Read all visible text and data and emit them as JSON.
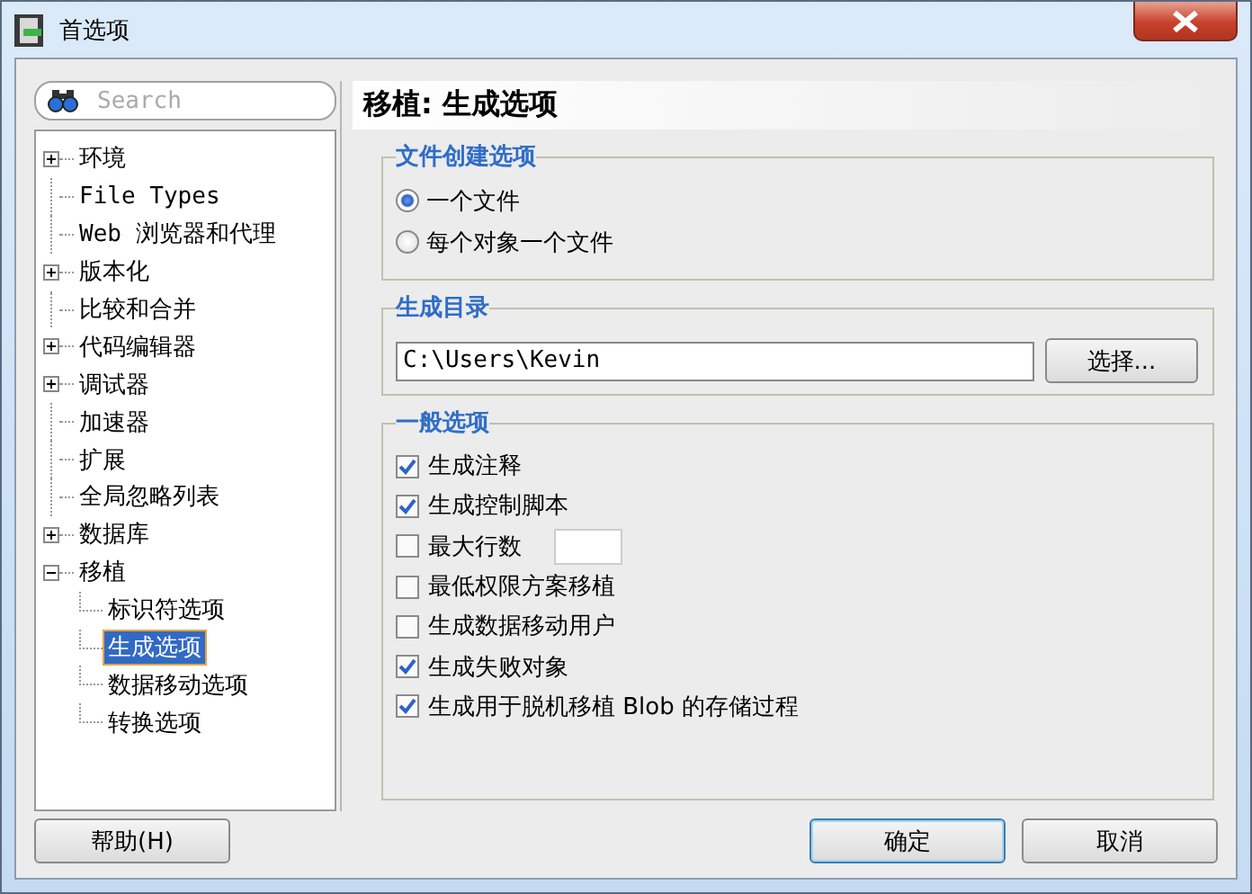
{
  "window": {
    "title": "首选项"
  },
  "search": {
    "placeholder": "Search"
  },
  "tree": [
    {
      "label": "环境",
      "expanded": false,
      "selected": false
    },
    {
      "label": "File Types",
      "selected": false
    },
    {
      "label": "Web 浏览器和代理",
      "selected": false
    },
    {
      "label": "版本化",
      "expanded": false,
      "selected": false
    },
    {
      "label": "比较和合并",
      "selected": false
    },
    {
      "label": "代码编辑器",
      "expanded": false,
      "selected": false
    },
    {
      "label": "调试器",
      "expanded": false,
      "selected": false
    },
    {
      "label": "加速器",
      "selected": false
    },
    {
      "label": "扩展",
      "selected": false
    },
    {
      "label": "全局忽略列表",
      "selected": false
    },
    {
      "label": "数据库",
      "expanded": false,
      "selected": false
    },
    {
      "label": "移植",
      "expanded": true,
      "selected": false,
      "children": [
        {
          "label": "标识符选项",
          "selected": false
        },
        {
          "label": "生成选项",
          "selected": true
        },
        {
          "label": "数据移动选项",
          "selected": false
        },
        {
          "label": "转换选项",
          "selected": false
        }
      ]
    }
  ],
  "page_title": "移植: 生成选项",
  "file_group": {
    "title": "文件创建选项",
    "options": [
      {
        "label": "一个文件",
        "selected": true
      },
      {
        "label": "每个对象一个文件",
        "selected": false
      }
    ]
  },
  "dir_group": {
    "title": "生成目录",
    "value": "C:\\Users\\Kevin",
    "button": "选择..."
  },
  "general_group": {
    "title": "一般选项",
    "options": [
      {
        "label": "生成注释",
        "checked": true,
        "kind": "check"
      },
      {
        "label": "生成控制脚本",
        "checked": true,
        "kind": "check"
      },
      {
        "label": "最大行数",
        "checked": false,
        "kind": "check_field"
      },
      {
        "label": "最低权限方案移植",
        "checked": false,
        "kind": "check"
      },
      {
        "label": "生成数据移动用户",
        "checked": false,
        "kind": "check"
      },
      {
        "label": "生成失败对象",
        "checked": true,
        "kind": "check"
      },
      {
        "label": "生成用于脱机移植 Blob 的存储过程",
        "checked": true,
        "kind": "check"
      }
    ]
  },
  "buttons": {
    "help": "帮助(H)",
    "ok": "确定",
    "cancel": "取消"
  }
}
